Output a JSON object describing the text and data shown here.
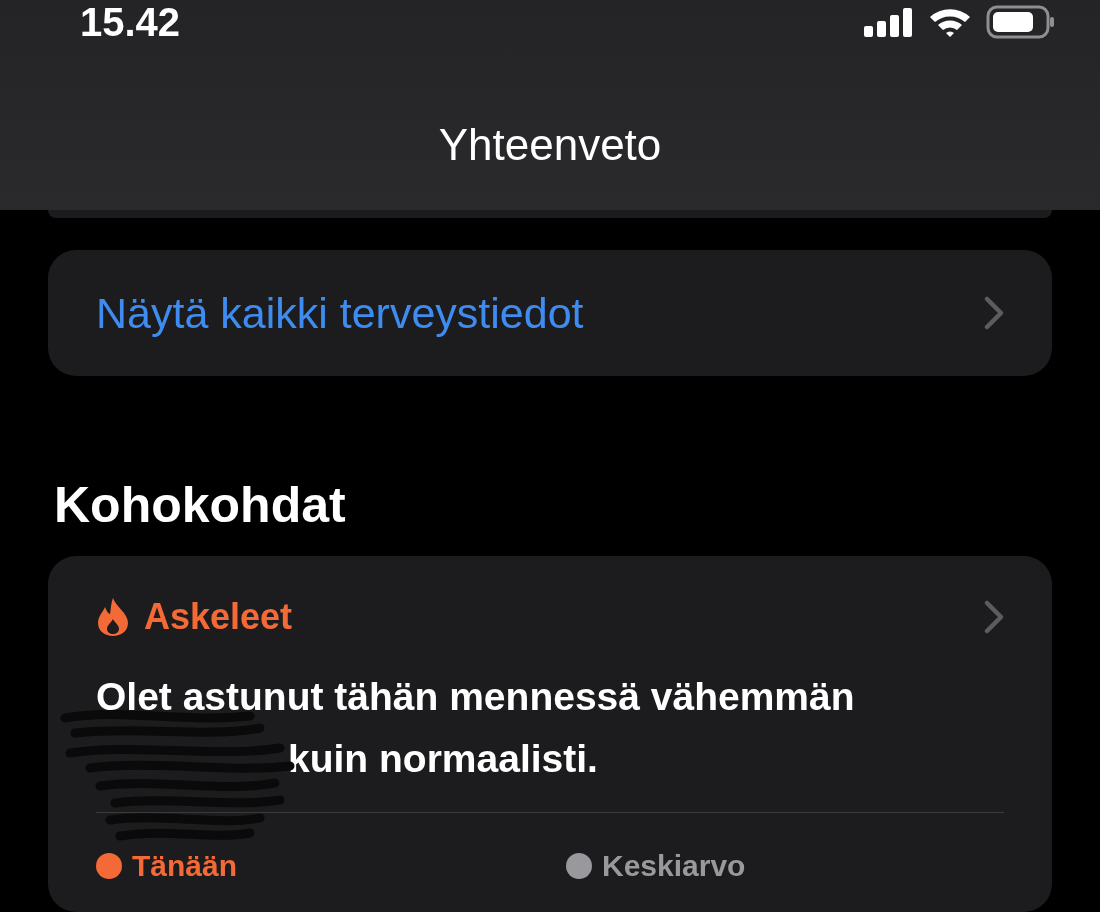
{
  "status_bar": {
    "time": "15.42"
  },
  "nav": {
    "title": "Yhteenveto"
  },
  "link_card": {
    "label": "Näytä kaikki terveystiedot"
  },
  "section": {
    "title": "Kohokohdat"
  },
  "highlight": {
    "category": "Askeleet",
    "lines": [
      "Olet astunut tähän mennessä vähemmän",
      "kuin normaalisti."
    ],
    "legend": [
      {
        "label": "Tänään",
        "color": "#f46a36"
      },
      {
        "label": "Keskiarvo",
        "color": "#98989d"
      }
    ]
  }
}
